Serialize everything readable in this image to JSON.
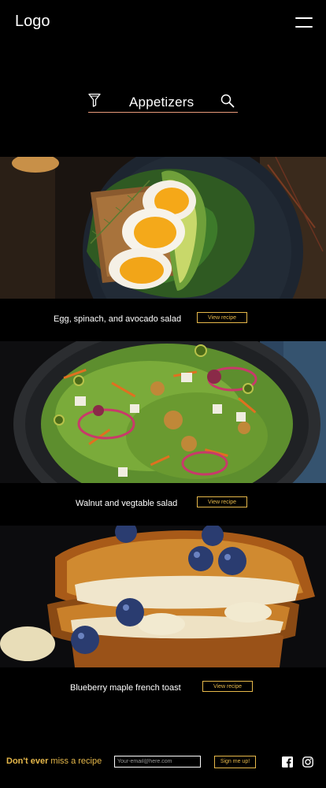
{
  "header": {
    "logo": "Logo",
    "menu_icon": "hamburger-menu-icon"
  },
  "search": {
    "filter_icon": "filter-funnel-icon",
    "query": "Appetizers",
    "search_icon": "magnifier-icon"
  },
  "recipes": [
    {
      "title": "Egg, spinach, and avocado salad",
      "button": "View recipe"
    },
    {
      "title": "Walnut and vegtable salad",
      "button": "View recipe"
    },
    {
      "title": "Blueberry maple french toast",
      "button": "View recipe"
    }
  ],
  "footer": {
    "tagline_bold": "Don't ever",
    "tagline_rest": " miss a recipe",
    "email_placeholder": "Your-email@here.com",
    "signup_label": "Sign me up!",
    "social": [
      "facebook-icon",
      "instagram-icon"
    ]
  },
  "colors": {
    "background": "#000000",
    "accent": "#e6b84a",
    "search_underline": "#e89a7a",
    "text": "#ffffff"
  }
}
